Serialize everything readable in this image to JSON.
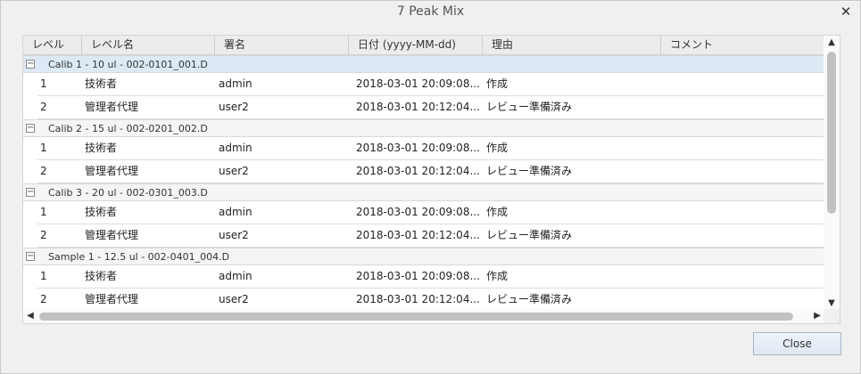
{
  "window": {
    "title": "7 Peak Mix",
    "close_glyph": "✕"
  },
  "columns": [
    "レベル",
    "レベル名",
    "署名",
    "日付 (yyyy-MM-dd)",
    "理由",
    "コメント"
  ],
  "groups": [
    {
      "label": "Calib 1 - 10 ul - 002-0101_001.D",
      "rows": [
        [
          "1",
          "技術者",
          "admin",
          "2018-03-01 20:09:08...",
          "作成",
          ""
        ],
        [
          "2",
          "管理者代理",
          "user2",
          "2018-03-01 20:12:04...",
          "レビュー準備済み",
          ""
        ]
      ]
    },
    {
      "label": "Calib 2 - 15 ul - 002-0201_002.D",
      "rows": [
        [
          "1",
          "技術者",
          "admin",
          "2018-03-01 20:09:08...",
          "作成",
          ""
        ],
        [
          "2",
          "管理者代理",
          "user2",
          "2018-03-01 20:12:04...",
          "レビュー準備済み",
          ""
        ]
      ]
    },
    {
      "label": "Calib 3 - 20 ul - 002-0301_003.D",
      "rows": [
        [
          "1",
          "技術者",
          "admin",
          "2018-03-01 20:09:08...",
          "作成",
          ""
        ],
        [
          "2",
          "管理者代理",
          "user2",
          "2018-03-01 20:12:04...",
          "レビュー準備済み",
          ""
        ]
      ]
    },
    {
      "label": "Sample 1 - 12.5 ul - 002-0401_004.D",
      "rows": [
        [
          "1",
          "技術者",
          "admin",
          "2018-03-01 20:09:08...",
          "作成",
          ""
        ],
        [
          "2",
          "管理者代理",
          "user2",
          "2018-03-01 20:12:04...",
          "レビュー準備済み",
          ""
        ]
      ]
    }
  ],
  "expand_glyph": "−",
  "scroll": {
    "up": "▲",
    "down": "▼",
    "left": "◀",
    "right": "▶"
  },
  "buttons": {
    "close_label": "Close"
  }
}
